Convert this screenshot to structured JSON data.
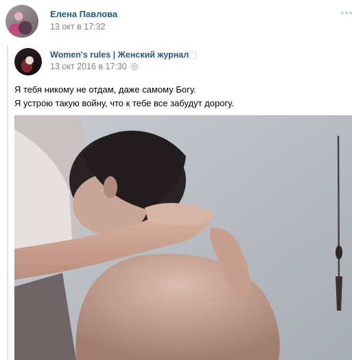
{
  "post": {
    "author": "Елена Павлова",
    "date": "13 окт в 17:32",
    "more_icon": "more-dots-icon"
  },
  "repost": {
    "group_name": "Women's rules | Женский журнал",
    "date": "13 окт 2016 в 17:30",
    "text_lines": [
      "Я тебя никому не отдам, даже самому Богу.",
      "Я устрою такую войну, что к тебе все забудут дорогу."
    ]
  },
  "colors": {
    "link": "#2a5885",
    "meta": "#828282",
    "repost_bar": "#dfe2e8"
  }
}
